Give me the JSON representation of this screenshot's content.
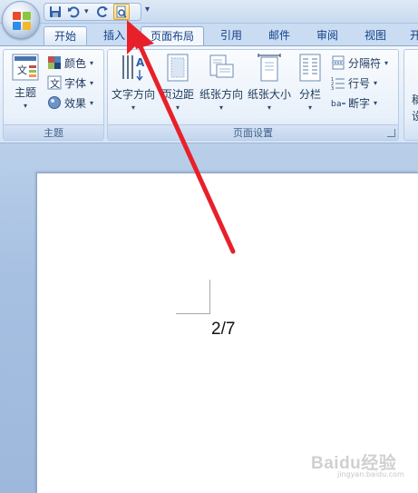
{
  "qat": {
    "buttons": [
      {
        "name": "save-icon"
      },
      {
        "name": "undo-icon"
      },
      {
        "name": "redo-icon"
      },
      {
        "name": "print-preview-icon"
      }
    ],
    "more_glyph": "▾"
  },
  "tabs": [
    "开始",
    "插入",
    "页面布局",
    "引用",
    "邮件",
    "审阅",
    "视图",
    "开"
  ],
  "active_tab": "页面布局",
  "ribbon": {
    "theme_group": {
      "label": "主题",
      "theme_button": "主题",
      "colors": "颜色",
      "fonts": "字体",
      "effects": "效果"
    },
    "page_setup_group": {
      "label": "页面设置",
      "text_direction": "文字方向",
      "margins": "页边距",
      "orientation": "纸张方向",
      "size": "纸张大小",
      "columns": "分栏",
      "breaks": "分隔符",
      "line_numbers": "行号",
      "hyphenation": "断字"
    },
    "truncated_group_chars": [
      "稿",
      "设"
    ]
  },
  "document": {
    "page_counter": "2/7"
  },
  "watermark": {
    "text": "Baidu经验",
    "sub": "jingyan.baidu.com"
  },
  "annotation_color": "#e8202a"
}
